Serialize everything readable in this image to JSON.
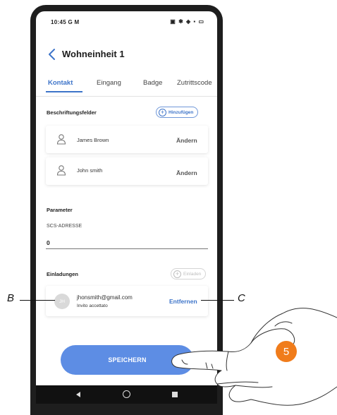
{
  "status_bar": {
    "time": "10:45",
    "indicators": "G M",
    "icons": "▣ ✱ ◈ ▪ ▭"
  },
  "header": {
    "back_icon": "chevron-left-icon",
    "title": "Wohneinheit 1"
  },
  "tabs": [
    {
      "label": "Kontakt",
      "active": true
    },
    {
      "label": "Eingang",
      "active": false
    },
    {
      "label": "Badge",
      "active": false
    },
    {
      "label": "Zutrittscode",
      "active": false
    }
  ],
  "labels_section": {
    "title": "Beschriftungsfelder",
    "add_button": "Hinzufügen",
    "items": [
      {
        "name": "James Brown",
        "action": "Ändern",
        "icon": "person-icon"
      },
      {
        "name": "John smith",
        "action": "Ändern",
        "icon": "person-icon"
      }
    ]
  },
  "parameters": {
    "title": "Parameter",
    "field_label": "SCS-ADRESSE",
    "field_value": "0"
  },
  "invitations": {
    "title": "Einladungen",
    "invite_button": "Einladen",
    "items": [
      {
        "avatar": "JH",
        "email": "jhonsmith@gmail.com",
        "status": "Invito accettato",
        "action": "Entfernen"
      }
    ]
  },
  "save_button": "SPEICHERN",
  "annotations": {
    "callout_b": "B",
    "callout_c": "C",
    "step_number": "5"
  },
  "colors": {
    "accent": "#3d74c9",
    "save_button": "#5d8de4",
    "step_badge": "#f07c1b"
  }
}
